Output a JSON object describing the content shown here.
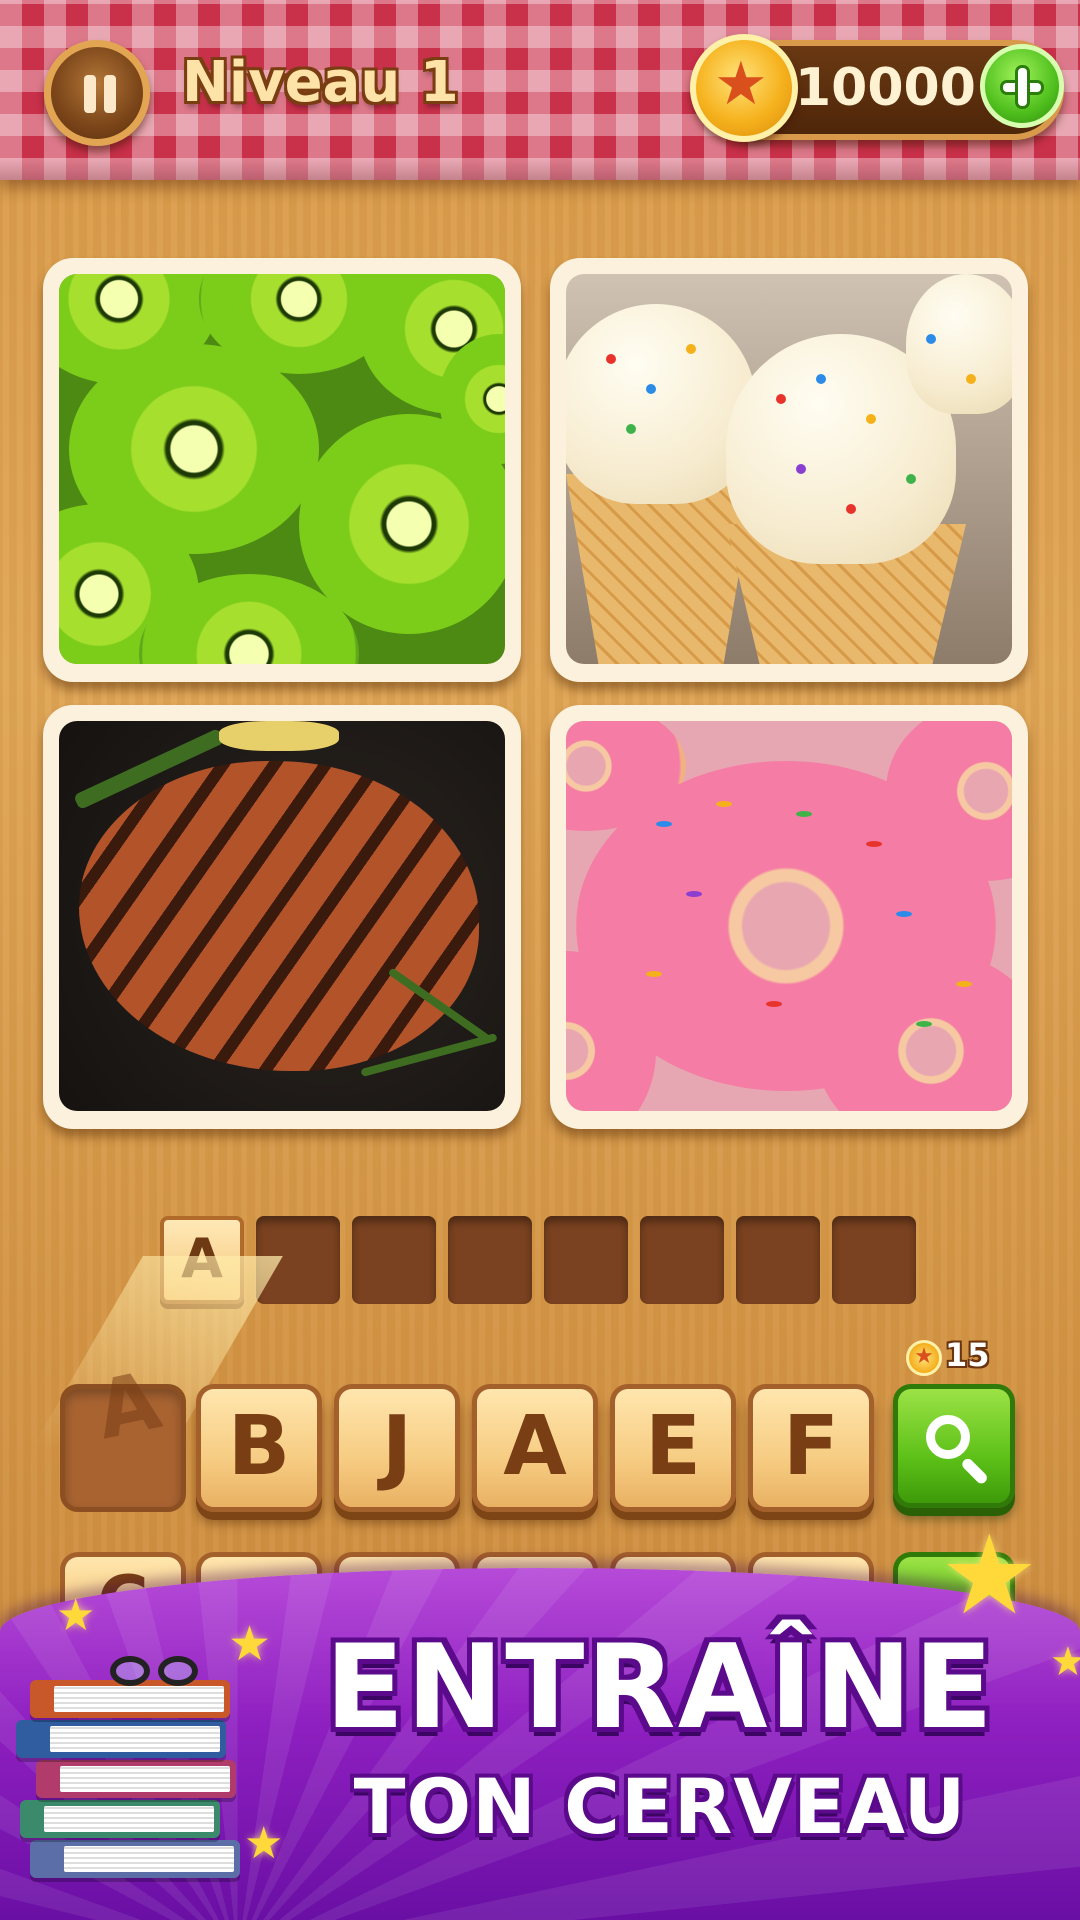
{
  "header": {
    "level_title": "Niveau 1",
    "coins": "10000",
    "pause_icon": "pause-icon",
    "coin_icon": "star-coin-icon",
    "add_icon": "plus-icon"
  },
  "photos": [
    {
      "subject": "kiwi"
    },
    {
      "subject": "ice-cream"
    },
    {
      "subject": "steak"
    },
    {
      "subject": "donut"
    }
  ],
  "answer": {
    "length": 8,
    "slots": [
      "A",
      "",
      "",
      "",
      "",
      "",
      "",
      ""
    ]
  },
  "letters": {
    "row1": [
      "A",
      "B",
      "J",
      "A",
      "E",
      "F"
    ],
    "used_index": 0,
    "row2_partial": [
      "C",
      "",
      "",
      "",
      "",
      ""
    ]
  },
  "hint": {
    "icon": "magnifier-icon",
    "cost": "15"
  },
  "banner": {
    "title": "ENTRAÎNE",
    "subtitle": "TON CERVEAU"
  },
  "colors": {
    "wood": "#dca04e",
    "banner_purple": "#8e1fc0",
    "hint_green": "#5dc118",
    "tablecloth_red": "#c9304a"
  }
}
